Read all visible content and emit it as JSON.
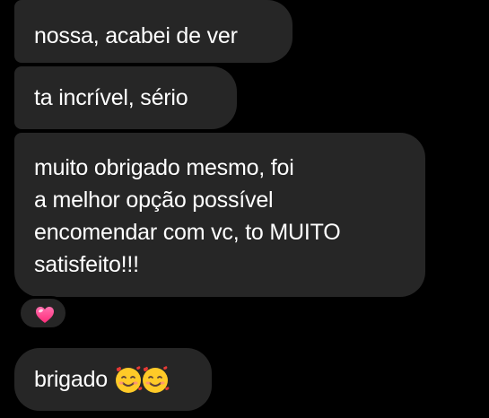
{
  "messages": [
    {
      "text": "nossa, acabei de ver"
    },
    {
      "text": "ta incrível, sério"
    },
    {
      "lines": [
        "muito obrigado mesmo, foi",
        "a melhor opção possível",
        "encomendar com vc, to MUITO",
        "satisfeito!!!"
      ]
    },
    {
      "text": "brigado",
      "emojis": [
        "smiling-face-with-hearts-icon",
        "smiling-face-with-hearts-icon"
      ]
    }
  ],
  "reaction": {
    "icon": "pink-heart-icon",
    "color": "#ff3d8e"
  },
  "colors": {
    "background": "#000000",
    "bubble": "#262626",
    "text": "#ffffff"
  }
}
